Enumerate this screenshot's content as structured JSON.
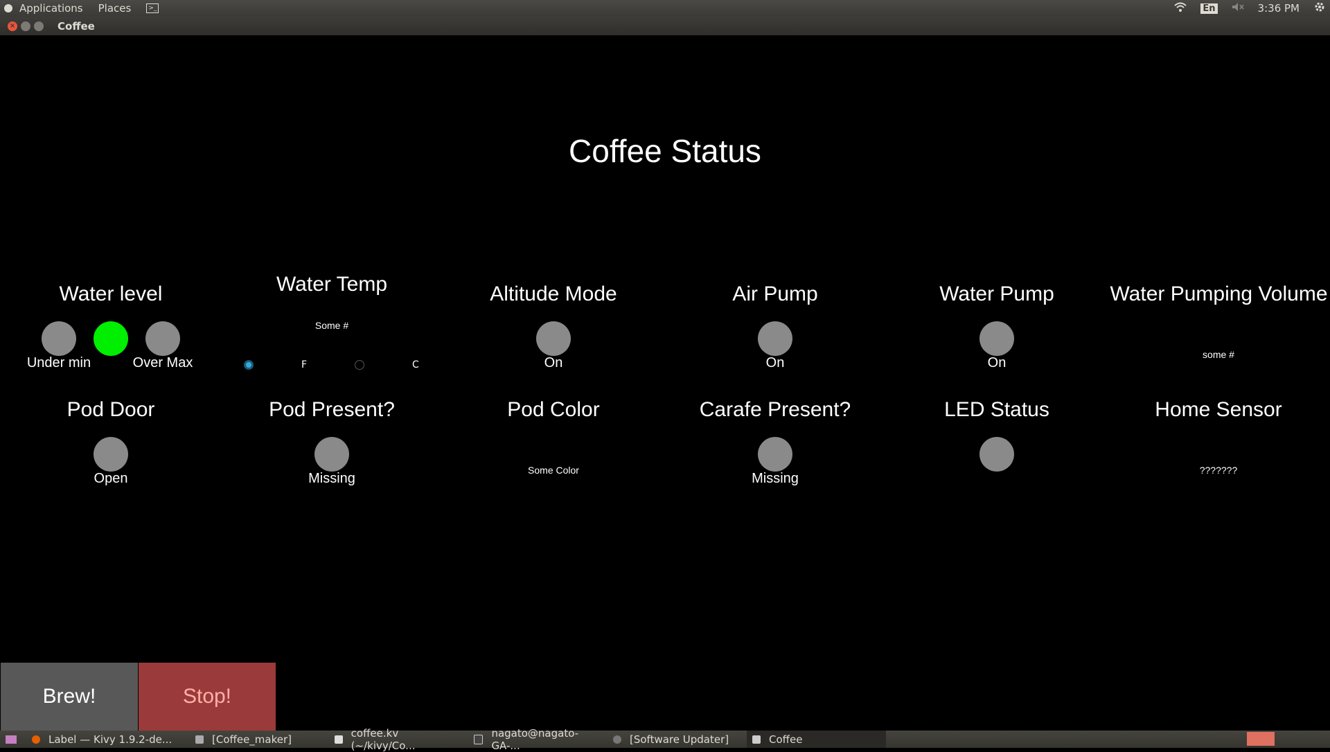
{
  "top_panel": {
    "menus": [
      "Applications",
      "Places"
    ],
    "language": "En",
    "clock": "3:36 PM"
  },
  "window": {
    "title": "Coffee"
  },
  "app": {
    "title": "Coffee Status",
    "water_level": {
      "label": "Water level",
      "under_label": "Under min",
      "over_label": "Over Max",
      "active_index": 1
    },
    "water_temp": {
      "label": "Water Temp",
      "value": "Some #",
      "unit_f": "F",
      "unit_c": "C",
      "selected": "F"
    },
    "altitude_mode": {
      "label": "Altitude Mode",
      "state": "On"
    },
    "air_pump": {
      "label": "Air Pump",
      "state": "On"
    },
    "water_pump": {
      "label": "Water Pump",
      "state": "On"
    },
    "water_pumping_volume": {
      "label": "Water Pumping Volume",
      "value": "some #"
    },
    "pod_door": {
      "label": "Pod Door",
      "state": "Open"
    },
    "pod_present": {
      "label": "Pod Present?",
      "state": "Missing"
    },
    "pod_color": {
      "label": "Pod Color",
      "value": "Some Color"
    },
    "carafe_present": {
      "label": "Carafe Present?",
      "state": "Missing"
    },
    "led_status": {
      "label": "LED Status"
    },
    "home_sensor": {
      "label": "Home Sensor",
      "value": "???????"
    },
    "brew_button": "Brew!",
    "stop_button": "Stop!"
  },
  "colors": {
    "led_on": "#00ee00",
    "led_off": "#8a8a8a",
    "stop_bg": "#9b3a3a",
    "brew_bg": "#585858"
  },
  "taskbar": {
    "tasks": [
      {
        "label": "Label — Kivy 1.9.2-de..."
      },
      {
        "label": "[Coffee_maker]"
      },
      {
        "label": "coffee.kv (~/kivy/Co..."
      },
      {
        "label": "nagato@nagato-GA-..."
      },
      {
        "label": "[Software Updater]"
      },
      {
        "label": "Coffee"
      }
    ]
  }
}
